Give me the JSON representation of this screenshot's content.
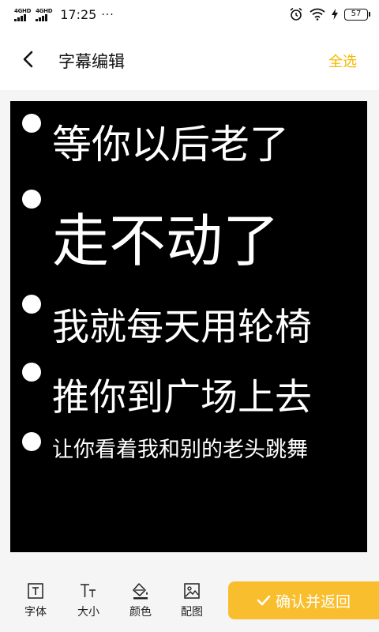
{
  "status_bar": {
    "net1": "4G",
    "net1_sup": "HD",
    "net2": "4G",
    "net2_sup": "HD",
    "time": "17:25",
    "dots": "···",
    "battery": "57"
  },
  "header": {
    "back_icon": "chevron-left-icon",
    "title": "字幕编辑",
    "select_all": "全选"
  },
  "preview": {
    "lines": [
      {
        "text": "等你以后老了"
      },
      {
        "text": "走不动了"
      },
      {
        "text": "我就每天用轮椅"
      },
      {
        "text": "推你到广场上去"
      },
      {
        "text": "让你看着我和别的老头跳舞"
      }
    ]
  },
  "toolbar": {
    "tools": [
      {
        "label": "字体",
        "icon": "font-icon"
      },
      {
        "label": "大小",
        "icon": "text-size-icon"
      },
      {
        "label": "颜色",
        "icon": "paint-bucket-icon"
      },
      {
        "label": "配图",
        "icon": "image-icon"
      }
    ],
    "confirm_label": "确认并返回",
    "confirm_icon": "checkmark-icon"
  },
  "colors": {
    "accent": "#f5b800",
    "confirm_bg": "#f9be2d",
    "preview_bg": "#000000",
    "subtitle_text": "#ffffff"
  }
}
